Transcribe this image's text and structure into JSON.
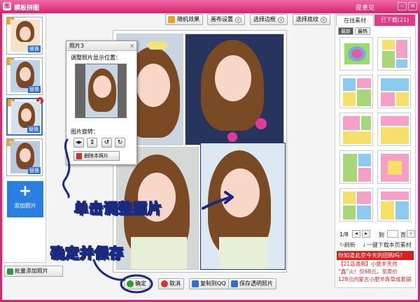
{
  "window": {
    "title": "模板拼图",
    "feedback": "提意见",
    "logo": "图"
  },
  "left_panel": {
    "thumbs": [
      {
        "num": "1",
        "replace": "替换"
      },
      {
        "num": "2",
        "replace": "替换"
      },
      {
        "num": "3",
        "replace": "替换"
      },
      {
        "num": "4",
        "replace": "替换"
      }
    ],
    "add_photo": "添加照片",
    "batch_add": "批量添加照片"
  },
  "toolbar": {
    "random": "随机效果",
    "canvas": "画布设置",
    "border": "选择边框",
    "texture": "选择底纹"
  },
  "photo_dialog": {
    "title": "照片3",
    "position_label": "调整照片显示位置：",
    "rotate_label": "图片旋转：",
    "delete_label": "删除本照片"
  },
  "bottom": {
    "ok": "确定",
    "cancel": "取消",
    "copy_qq": "复制到QQ",
    "save": "保存透明照片"
  },
  "right_panel": {
    "tab_online": "在线素材",
    "tab_downloaded": "已下载(21)",
    "sub_new": "最新",
    "sub_hot": "最热",
    "page_info": "1/8",
    "goto": "到",
    "page_suffix": "页",
    "refresh": "刷新",
    "download_all": "一键下载本页素材",
    "ad": {
      "header": "你知道此京今天的团购吗?",
      "lines": [
        "【21店通用】小肥羊天然",
        "“鑫”火！仅68元，享原价",
        "128元内蒙古小肥羊青草成套锅"
      ]
    }
  },
  "annotations": {
    "click_adjust": "单击调整照片",
    "confirm_save": "确定并保存"
  },
  "colors": {
    "accent": "#d6246f",
    "primary_blue": "#2a80e0",
    "annotation_stroke": "#1a2a80"
  }
}
